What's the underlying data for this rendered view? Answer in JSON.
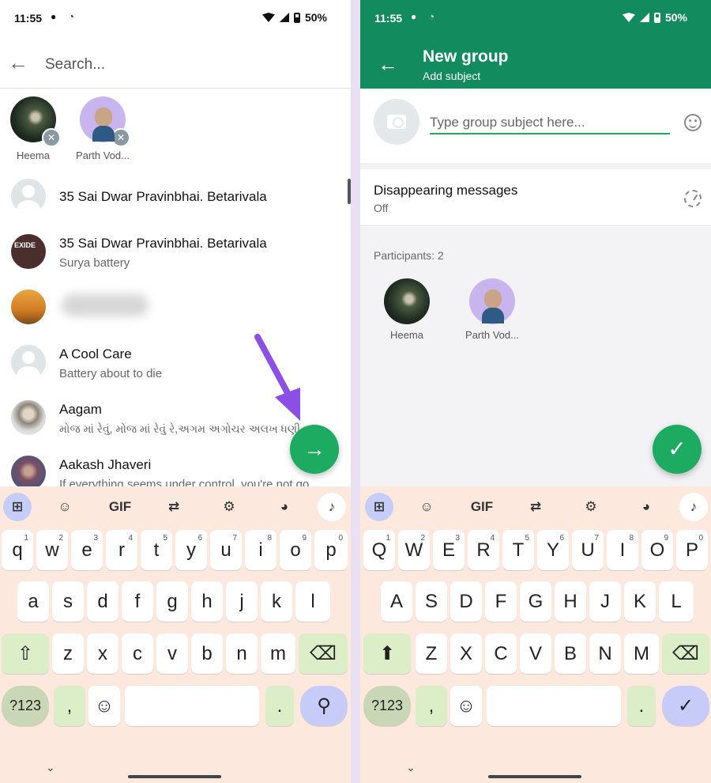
{
  "status": {
    "time": "11:55",
    "battery": "50%"
  },
  "left": {
    "search_placeholder": "Search...",
    "selected": [
      {
        "name": "Heema",
        "avatar": "photo"
      },
      {
        "name": "Parth Vod...",
        "avatar": "emoji"
      }
    ],
    "contacts": [
      {
        "name": "35 Sai Dwar Pravinbhai. Betarivala",
        "sub": "",
        "avatar": "default"
      },
      {
        "name": "35 Sai Dwar Pravinbhai. Betarivala",
        "sub": "Surya battery",
        "avatar": "exide"
      },
      {
        "name": "",
        "sub": "",
        "avatar": "solar",
        "blurred": true
      },
      {
        "name": "A Cool Care",
        "sub": "Battery about to die",
        "avatar": "default"
      },
      {
        "name": "Aagam",
        "sub": "મોજ માં રેવું, મોજ માં રેવું રે,અગમ અગોચર અલખ ધણી...",
        "avatar": "person1"
      },
      {
        "name": "Aakash Jhaveri",
        "sub": "If everything seems under control, you're not go...",
        "avatar": "person2"
      }
    ],
    "fab_icon": "arrow-right-icon"
  },
  "right": {
    "title": "New group",
    "subtitle": "Add subject",
    "subject_placeholder": "Type group subject here...",
    "disappearing_title": "Disappearing messages",
    "disappearing_value": "Off",
    "participants_label": "Participants: 2",
    "participants": [
      {
        "name": "Heema",
        "avatar": "photo"
      },
      {
        "name": "Parth Vod...",
        "avatar": "emoji"
      }
    ],
    "fab_icon": "check-icon"
  },
  "keyboard": {
    "tools": [
      "apps-grid-icon",
      "sticker-icon",
      "GIF",
      "translate-icon",
      "gear-icon",
      "palette-icon",
      "mic-icon"
    ],
    "numbers": [
      "1",
      "2",
      "3",
      "4",
      "5",
      "6",
      "7",
      "8",
      "9",
      "0"
    ],
    "left_rows": [
      [
        "q",
        "w",
        "e",
        "r",
        "t",
        "y",
        "u",
        "i",
        "o",
        "p"
      ],
      [
        "a",
        "s",
        "d",
        "f",
        "g",
        "h",
        "j",
        "k",
        "l"
      ],
      [
        "z",
        "x",
        "c",
        "v",
        "b",
        "n",
        "m"
      ]
    ],
    "right_rows": [
      [
        "Q",
        "W",
        "E",
        "R",
        "T",
        "Y",
        "U",
        "I",
        "O",
        "P"
      ],
      [
        "A",
        "S",
        "D",
        "F",
        "G",
        "H",
        "J",
        "K",
        "L"
      ],
      [
        "Z",
        "X",
        "C",
        "V",
        "B",
        "N",
        "M"
      ]
    ],
    "symbols_label": "?123",
    "comma": ",",
    "period": "."
  },
  "colors": {
    "accent": "#1daa61",
    "appbar": "#128c5e",
    "keyboard_bg": "#fde8de"
  }
}
